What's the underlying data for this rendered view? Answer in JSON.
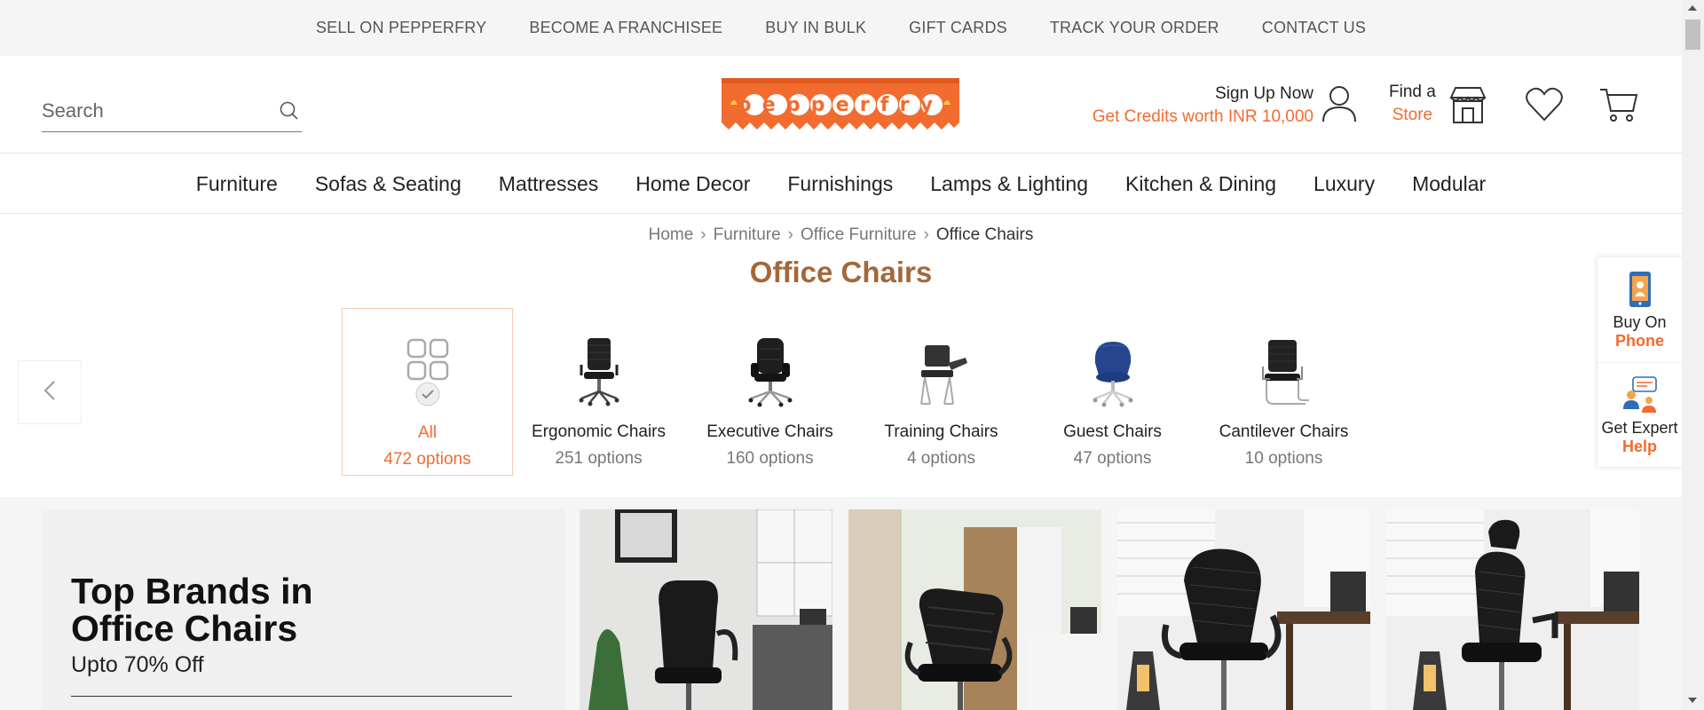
{
  "top_links": [
    "SELL ON PEPPERFRY",
    "BECOME A FRANCHISEE",
    "BUY IN BULK",
    "GIFT CARDS",
    "TRACK YOUR ORDER",
    "CONTACT US"
  ],
  "search": {
    "placeholder": "Search"
  },
  "logo": {
    "text": "pepperfry"
  },
  "account": {
    "signup_label": "Sign Up Now",
    "credits_label": "Get Credits worth INR 10,000"
  },
  "store": {
    "line1": "Find a",
    "line2": "Store"
  },
  "categories": [
    "Furniture",
    "Sofas & Seating",
    "Mattresses",
    "Home Decor",
    "Furnishings",
    "Lamps & Lighting",
    "Kitchen & Dining",
    "Luxury",
    "Modular"
  ],
  "breadcrumb": [
    "Home",
    "Furniture",
    "Office Furniture",
    "Office Chairs"
  ],
  "page_title": "Office Chairs",
  "subcategories": [
    {
      "name": "All",
      "count": "472 options",
      "selected": true
    },
    {
      "name": "Ergonomic Chairs",
      "count": "251 options"
    },
    {
      "name": "Executive Chairs",
      "count": "160 options"
    },
    {
      "name": "Training Chairs",
      "count": "4 options"
    },
    {
      "name": "Guest Chairs",
      "count": "47 options"
    },
    {
      "name": "Cantilever Chairs",
      "count": "10 options"
    }
  ],
  "side_widget": {
    "phone": {
      "line1": "Buy On",
      "line2": "Phone"
    },
    "expert": {
      "line1": "Get Expert",
      "line2": "Help"
    }
  },
  "banner": {
    "title_line1": "Top Brands in",
    "title_line2": "Office Chairs",
    "subtitle": "Upto 70% Off"
  },
  "colors": {
    "accent": "#f26b2f",
    "title": "#a3683a",
    "topbar_bg": "#f5f5f5"
  }
}
